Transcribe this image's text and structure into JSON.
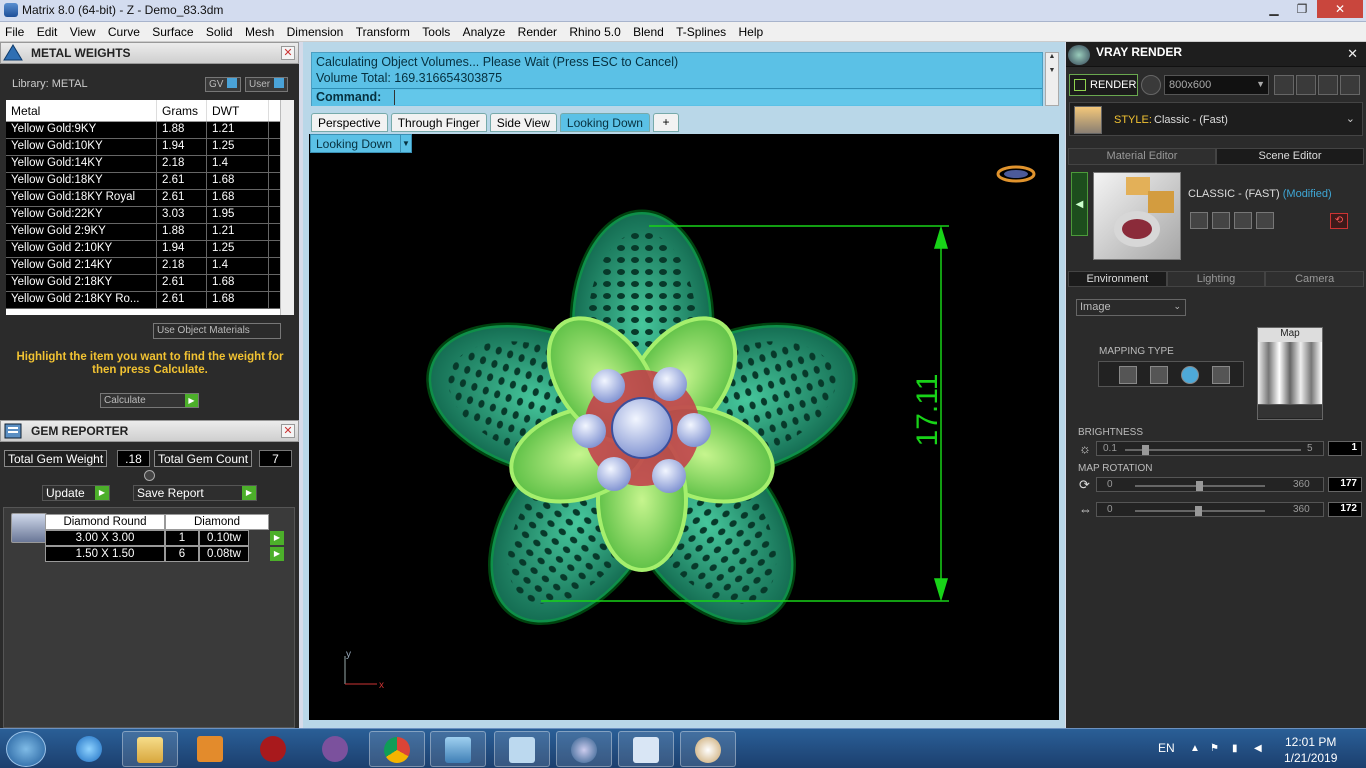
{
  "window": {
    "title": "Matrix 8.0 (64-bit) - Z - Demo_83.3dm",
    "min_label": "▁",
    "max_label": "❐",
    "close_label": "✕"
  },
  "menu": [
    "File",
    "Edit",
    "View",
    "Curve",
    "Surface",
    "Solid",
    "Mesh",
    "Dimension",
    "Transform",
    "Tools",
    "Analyze",
    "Render",
    "Rhino 5.0",
    "Blend",
    "T-Splines",
    "Help"
  ],
  "metal_weights": {
    "title": "METAL WEIGHTS",
    "library_label": "Library: METAL",
    "gv_label": "GV",
    "user_label": "User",
    "columns": [
      "Metal",
      "Grams",
      "DWT"
    ],
    "rows": [
      [
        "Yellow Gold:9KY",
        "1.88",
        "1.21"
      ],
      [
        "Yellow Gold:10KY",
        "1.94",
        "1.25"
      ],
      [
        "Yellow Gold:14KY",
        "2.18",
        "1.4"
      ],
      [
        "Yellow Gold:18KY",
        "2.61",
        "1.68"
      ],
      [
        "Yellow Gold:18KY Royal",
        "2.61",
        "1.68"
      ],
      [
        "Yellow Gold:22KY",
        "3.03",
        "1.95"
      ],
      [
        "Yellow Gold 2:9KY",
        "1.88",
        "1.21"
      ],
      [
        "Yellow Gold 2:10KY",
        "1.94",
        "1.25"
      ],
      [
        "Yellow Gold 2:14KY",
        "2.18",
        "1.4"
      ],
      [
        "Yellow Gold 2:18KY",
        "2.61",
        "1.68"
      ],
      [
        "Yellow Gold 2:18KY Ro...",
        "2.61",
        "1.68"
      ]
    ],
    "use_object_materials": "Use Object Materials",
    "hint": "Highlight the item you want to find the weight for then press Calculate.",
    "calculate_label": "Calculate"
  },
  "gem_reporter": {
    "title": "GEM REPORTER",
    "total_weight_label": "Total Gem Weight",
    "total_weight_value": ".18",
    "total_count_label": "Total Gem Count",
    "total_count_value": "7",
    "update_label": "Update",
    "save_report_label": "Save Report",
    "table_header": [
      "Diamond Round",
      "",
      "Diamond"
    ],
    "rows": [
      [
        "3.00 X 3.00",
        "1",
        "0.10tw"
      ],
      [
        "1.50 X 1.50",
        "6",
        "0.08tw"
      ]
    ]
  },
  "command": {
    "line1": "Calculating Object Volumes... Please Wait (Press ESC to Cancel)",
    "line2": "Volume Total: 169.316654303875",
    "prompt_label": "Command:",
    "input_value": ""
  },
  "viewport_tabs": [
    "Perspective",
    "Through Finger",
    "Side View",
    "Looking Down",
    "+"
  ],
  "active_tab": "Looking Down",
  "view_selector": "Looking Down",
  "viewport": {
    "dimension_label": "17.11",
    "axis_y": "y",
    "axis_x": "x"
  },
  "vray": {
    "title": "VRAY RENDER",
    "render_label": "RENDER",
    "resolution": "800x600",
    "style_label": "STYLE:",
    "style_value": "Classic - (Fast)",
    "tabs": [
      "Material Editor",
      "Scene Editor"
    ],
    "preset_name": "CLASSIC - (FAST)",
    "preset_state": "(Modified)",
    "env_tabs": [
      "Environment",
      "Lighting",
      "Camera"
    ],
    "env_source": "Image",
    "mapping_type_label": "MAPPING TYPE",
    "map_title": "Map",
    "brightness_label": "BRIGHTNESS",
    "brightness_min": "0.1",
    "brightness_max": "5",
    "brightness_value": "1",
    "brightness_level": 0.06,
    "map_rotation_label": "MAP ROTATION",
    "rotation1_min": "0",
    "rotation1_max": "360",
    "rotation1_value": "177",
    "rotation2_min": "0",
    "rotation2_max": "360",
    "rotation2_value": "172"
  },
  "taskbar": {
    "lang": "EN",
    "time": "12:01 PM",
    "date": "1/21/2019"
  },
  "colors": {
    "command_bg": "#5bc1e6",
    "hint_text": "#f1c232",
    "dimension_green": "#18d318",
    "modified_blue": "#3fa7d6"
  }
}
